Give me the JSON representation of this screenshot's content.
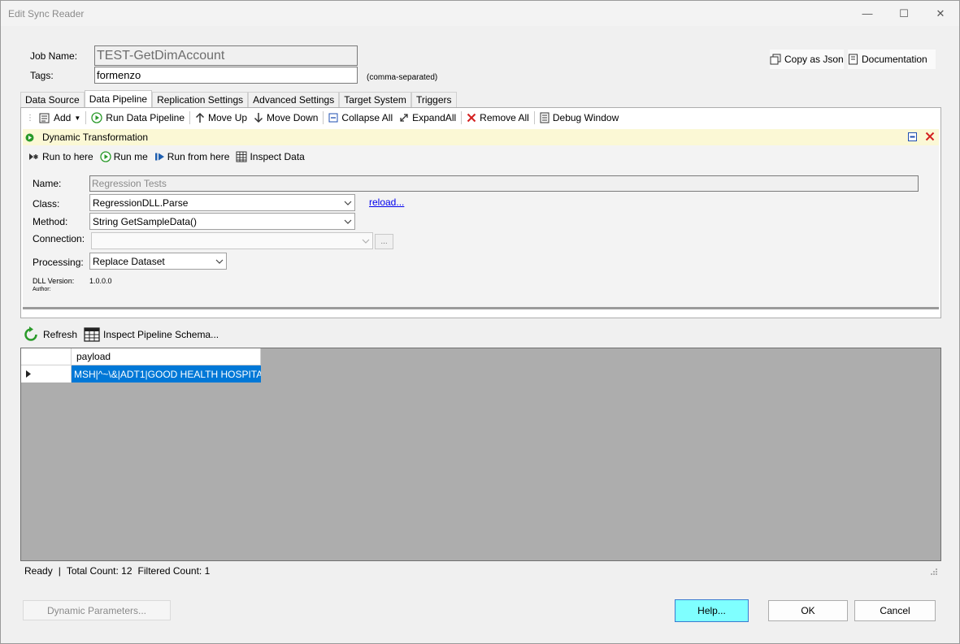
{
  "window": {
    "title": "Edit Sync Reader",
    "minimize_glyph": "—",
    "maximize_glyph": "☐",
    "close_glyph": "✕"
  },
  "job": {
    "job_name_label": "Job Name:",
    "job_name_value": "TEST-GetDimAccount",
    "tags_label": "Tags:",
    "tags_value": "formenzo",
    "tags_hint": "(comma-separated)"
  },
  "top_buttons": {
    "copy_json": "Copy as Json",
    "documentation": "Documentation"
  },
  "tabs": [
    {
      "label": "Data Source"
    },
    {
      "label": "Data Pipeline",
      "active": true
    },
    {
      "label": "Replication Settings"
    },
    {
      "label": "Advanced Settings"
    },
    {
      "label": "Target System"
    },
    {
      "label": "Triggers"
    }
  ],
  "pipeline_toolbar": {
    "add": "Add",
    "run_pipeline": "Run Data Pipeline",
    "move_up": "Move Up",
    "move_down": "Move Down",
    "collapse_all": "Collapse All",
    "expand_all": "ExpandAll",
    "remove_all": "Remove All",
    "debug_window": "Debug Window"
  },
  "step": {
    "title": "Dynamic Transformation",
    "run_to_here": "Run to here",
    "run_me": "Run me",
    "run_from_here": "Run from here",
    "inspect_data": "Inspect Data",
    "name_label": "Name:",
    "name_value": "Regression Tests",
    "class_label": "Class:",
    "class_value": "RegressionDLL.Parse",
    "reload_link": "reload...",
    "method_label": "Method:",
    "method_value": "String GetSampleData()",
    "connection_label": "Connection:",
    "connection_value": "",
    "connection_browse": "...",
    "processing_label": "Processing:",
    "processing_value": "Replace Dataset",
    "dll_version_label": "DLL Version:",
    "dll_version_value": "1.0.0.0",
    "author_label": "Author:"
  },
  "results_toolbar": {
    "refresh": "Refresh",
    "inspect_schema": "Inspect Pipeline Schema..."
  },
  "grid": {
    "columns": [
      "payload"
    ],
    "rows": [
      {
        "payload": "MSH|^~\\&|ADT1|GOOD HEALTH HOSPITA..."
      }
    ]
  },
  "status": {
    "ready": "Ready",
    "sep": "|",
    "total": "Total Count: 12",
    "filtered": "Filtered Count: 1"
  },
  "bottom_buttons": {
    "dynamic_params": "Dynamic Parameters...",
    "help": "Help...",
    "ok": "OK",
    "cancel": "Cancel"
  },
  "colors": {
    "selection": "#0078d7",
    "step_header": "#fbf8d5",
    "help_button": "#7fffff",
    "grid_background": "#adadad"
  },
  "icons": [
    "copy-icon",
    "document-icon",
    "add-icon",
    "play-circle-icon",
    "arrow-up-icon",
    "arrow-down-icon",
    "collapse-icon",
    "expand-icon",
    "remove-x-icon",
    "debug-window-icon",
    "run-to-here-icon",
    "run-from-here-icon",
    "inspect-grid-icon",
    "refresh-icon",
    "table-icon",
    "chevron-down-icon",
    "row-pointer-icon",
    "resize-grip-icon"
  ]
}
